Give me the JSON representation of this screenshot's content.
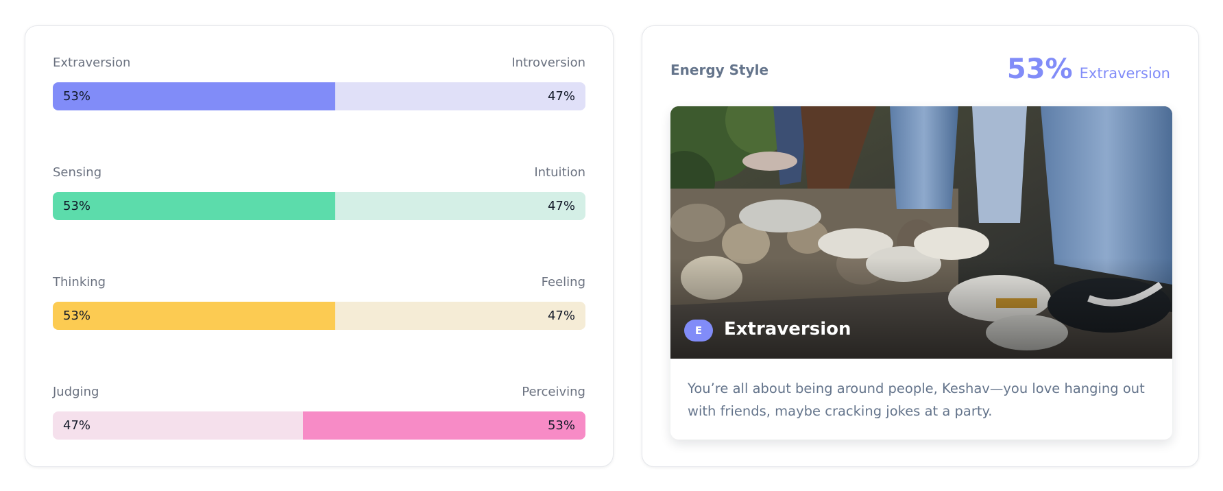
{
  "traits": [
    {
      "left_label": "Extraversion",
      "right_label": "Introversion",
      "left_pct": "53%",
      "right_pct": "47%",
      "fill_fraction": 0.53,
      "fill_side": "left",
      "fill_color": "#818cf8",
      "track_color": "#e0e0f8"
    },
    {
      "left_label": "Sensing",
      "right_label": "Intuition",
      "left_pct": "53%",
      "right_pct": "47%",
      "fill_fraction": 0.53,
      "fill_side": "left",
      "fill_color": "#5cdcab",
      "track_color": "#d4efe6"
    },
    {
      "left_label": "Thinking",
      "right_label": "Feeling",
      "left_pct": "53%",
      "right_pct": "47%",
      "fill_fraction": 0.53,
      "fill_side": "left",
      "fill_color": "#fccb52",
      "track_color": "#f5ecd6"
    },
    {
      "left_label": "Judging",
      "right_label": "Perceiving",
      "left_pct": "47%",
      "right_pct": "53%",
      "fill_fraction": 0.53,
      "fill_side": "right",
      "fill_color": "#f78bc6",
      "track_color": "#f5e0ec"
    }
  ],
  "energy": {
    "title": "Energy Style",
    "pct": "53%",
    "name": "Extraversion",
    "badge": "E",
    "caption": "Extraversion",
    "description": "You’re all about being around people, Keshav—you love hanging out with friends, maybe cracking jokes at a party.",
    "accent_color": "#818cf8"
  }
}
